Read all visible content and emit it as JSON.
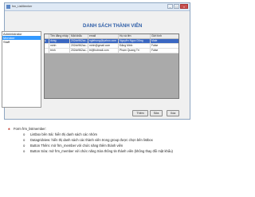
{
  "window": {
    "title": "frm_ListMember"
  },
  "listbox": {
    "items": [
      "Administrator",
      "Member",
      "Staff"
    ],
    "selected_index": 1
  },
  "heading": "DANH SÁCH THÀNH VIÊN",
  "grid": {
    "columns": [
      "Tên đăng nhập",
      "Mật khẩu",
      "email",
      "Họ và tên",
      "Giới tính"
    ],
    "rows": [
      [
        "dung",
        "202cb962ac...",
        "nglehung@yahoo.com",
        "Nguyễn Ngọc Dũng",
        "Male"
      ],
      [
        "minh",
        "202cb962ac...",
        "minh@gmail.com",
        "Đặng Minh",
        "False"
      ],
      [
        "trinh",
        "202cb962ac...",
        "tri@hotmail.com",
        "Phạm Quang Trí",
        "False"
      ]
    ],
    "selected_row": 0
  },
  "buttons": {
    "add": "Thêm",
    "edit": "Sửa",
    "delete": "Xóa"
  },
  "notes": {
    "title": "Form frm_listmember:",
    "items": [
      "Listbox bên trái: hiển thị danh sách các nhóm",
      "Datagridview: hiển thị danh sách các thành viên trong group được chọn bên listbox",
      "Button Thêm: mở frm_member với chức năng thêm thành viên",
      "Button Sửa: mở frm_member với chức năng Sửa thông tin thành viên (không thay đổi mật khẩu)"
    ]
  }
}
